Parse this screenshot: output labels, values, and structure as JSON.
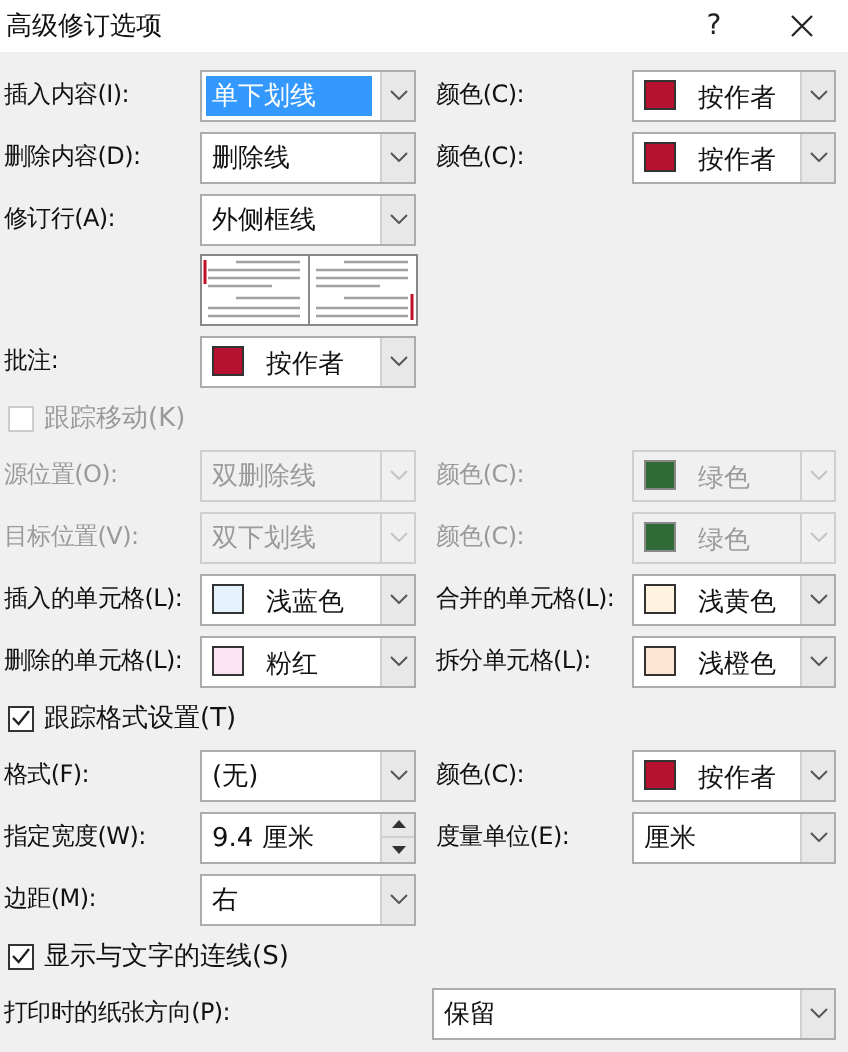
{
  "window": {
    "title": "高级修订选项",
    "help_button": "?"
  },
  "rows": [
    {
      "kind": "pair",
      "left": {
        "label": "插入内容(I):",
        "kind": "combo",
        "value": "单下划线",
        "selected": true,
        "disabled": false
      },
      "right": {
        "label": "颜色(C):",
        "kind": "combo",
        "value": "按作者",
        "color": "#b4122e",
        "selected": false,
        "disabled": false
      }
    },
    {
      "kind": "pair",
      "left": {
        "label": "删除内容(D):",
        "kind": "combo",
        "value": "删除线",
        "selected": false,
        "disabled": false
      },
      "right": {
        "label": "颜色(C):",
        "kind": "combo",
        "value": "按作者",
        "color": "#b4122e",
        "selected": false,
        "disabled": false
      }
    },
    {
      "kind": "pair",
      "left": {
        "label": "修订行(A):",
        "kind": "combo",
        "value": "外侧框线",
        "selected": false,
        "disabled": false
      }
    },
    {
      "kind": "preview"
    },
    {
      "kind": "pair",
      "left": {
        "label": "批注:",
        "kind": "combo",
        "value": "按作者",
        "color": "#b4122e",
        "selected": false,
        "disabled": false
      }
    },
    {
      "kind": "check",
      "label": "跟踪移动(K)",
      "checked": false,
      "disabled": true
    },
    {
      "kind": "pair",
      "left": {
        "label": "源位置(O):",
        "kind": "combo",
        "value": "双删除线",
        "selected": false,
        "disabled": true
      },
      "right": {
        "label": "颜色(C):",
        "kind": "combo",
        "value": "绿色",
        "color": "#2e6b36",
        "selected": false,
        "disabled": true
      }
    },
    {
      "kind": "pair",
      "left": {
        "label": "目标位置(V):",
        "kind": "combo",
        "value": "双下划线",
        "selected": false,
        "disabled": true
      },
      "right": {
        "label": "颜色(C):",
        "kind": "combo",
        "value": "绿色",
        "color": "#2e6b36",
        "selected": false,
        "disabled": true
      }
    },
    {
      "kind": "pair",
      "left": {
        "label": "插入的单元格(L):",
        "kind": "combo",
        "value": "浅蓝色",
        "color": "#e3f2fb",
        "selected": false,
        "disabled": false
      },
      "right": {
        "label": "合并的单元格(L):",
        "kind": "combo",
        "value": "浅黄色",
        "color": "#fff3df",
        "selected": false,
        "disabled": false
      }
    },
    {
      "kind": "pair",
      "left": {
        "label": "删除的单元格(L):",
        "kind": "combo",
        "value": "粉红",
        "color": "#fbe3f2",
        "selected": false,
        "disabled": false
      },
      "right": {
        "label": "拆分单元格(L):",
        "kind": "combo",
        "value": "浅橙色",
        "color": "#fde5d2",
        "selected": false,
        "disabled": false
      }
    },
    {
      "kind": "check",
      "label": "跟踪格式设置(T)",
      "checked": true,
      "disabled": false
    },
    {
      "kind": "pair",
      "left": {
        "label": "格式(F):",
        "kind": "combo",
        "value": "(无)",
        "selected": false,
        "disabled": false
      },
      "right": {
        "label": "颜色(C):",
        "kind": "combo",
        "value": "按作者",
        "color": "#b4122e",
        "selected": false,
        "disabled": false
      }
    },
    {
      "kind": "pair",
      "left": {
        "label": "指定宽度(W):",
        "kind": "spin",
        "value": "9.4 厘米",
        "selected": false,
        "disabled": false
      },
      "right": {
        "label": "度量单位(E):",
        "kind": "combo",
        "value": "厘米",
        "selected": false,
        "disabled": false
      }
    },
    {
      "kind": "pair",
      "left": {
        "label": "边距(M):",
        "kind": "combo",
        "value": "右",
        "selected": false,
        "disabled": false
      }
    },
    {
      "kind": "check",
      "label": "显示与文字的连线(S)",
      "checked": true,
      "disabled": false
    },
    {
      "kind": "wide",
      "label": "打印时的纸张方向(P):",
      "field": {
        "kind": "combo",
        "value": "保留",
        "selected": false,
        "disabled": false
      }
    }
  ]
}
